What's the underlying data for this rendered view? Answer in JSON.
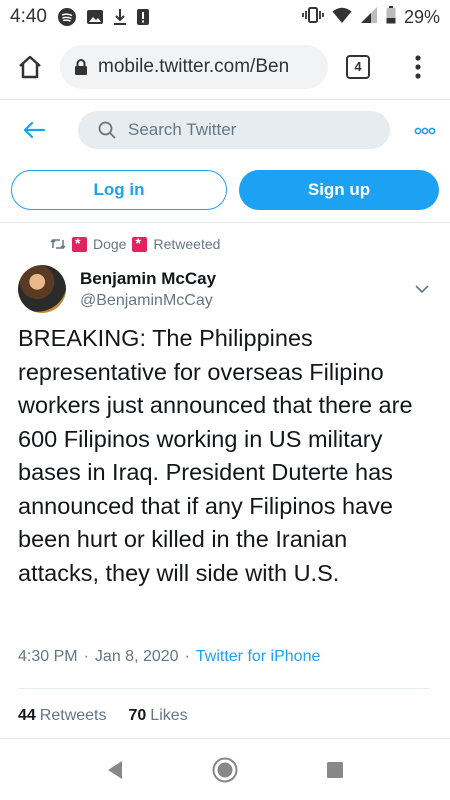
{
  "status_bar": {
    "time": "4:40",
    "battery": "29%"
  },
  "browser": {
    "url": "mobile.twitter.com/Ben",
    "tab_count": "4"
  },
  "header": {
    "search_placeholder": "Search Twitter"
  },
  "auth": {
    "login_label": "Log in",
    "signup_label": "Sign up"
  },
  "retweet": {
    "retweeter": "Doge",
    "label": "Retweeted"
  },
  "tweet": {
    "author_name": "Benjamin McCay",
    "author_handle": "@BenjaminMcCay",
    "text": "BREAKING: The Philippines representative for overseas Filipino workers just announced that there are 600 Filipinos working in US military bases in Iraq. President Duterte has announced that if any Filipinos have been hurt or killed in the Iranian attacks, they will side with U.S.",
    "time": "4:30 PM",
    "date": "Jan 8, 2020",
    "source": "Twitter for iPhone",
    "retweets_count": "44",
    "retweets_label": "Retweets",
    "likes_count": "70",
    "likes_label": "Likes"
  },
  "colors": {
    "accent": "#1da1f2",
    "text_primary": "#14171a",
    "text_secondary": "#657786",
    "siren": "#e0245e"
  },
  "icons": [
    "home-icon",
    "lock-icon",
    "tabs-icon",
    "menu-dots-icon",
    "back-arrow-icon",
    "search-icon",
    "more-icon",
    "retweet-icon",
    "siren-icon",
    "chevron-down-icon",
    "nav-back-icon",
    "nav-home-icon",
    "nav-recents-icon"
  ]
}
